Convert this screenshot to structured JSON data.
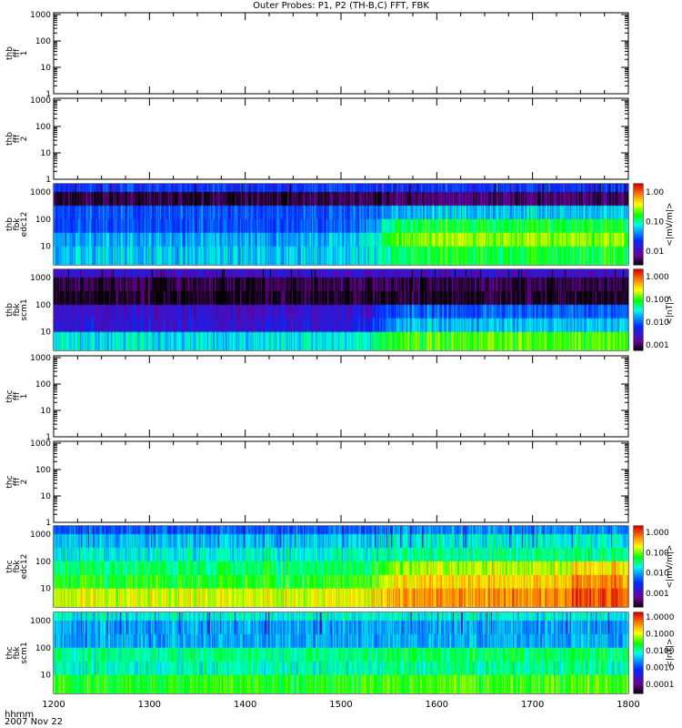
{
  "chart_data": {
    "type": "heatmap",
    "title": "Outer Probes: P1, P2 (TH-B,C) FFT, FBK",
    "xlabel": "hhmm",
    "date_label": "2007 Nov 22",
    "x_range": [
      1200,
      1800
    ],
    "x_ticks": [
      "1200",
      "1300",
      "1400",
      "1500",
      "1600",
      "1700",
      "1800"
    ],
    "panels": [
      {
        "label": [
          "thb",
          "fff",
          "1"
        ],
        "kind": "empty",
        "y_range": [
          1,
          1170
        ],
        "y_ticks": [
          "1000",
          "100",
          "10",
          "1"
        ]
      },
      {
        "label": [
          "thb",
          "fff",
          "2"
        ],
        "kind": "empty",
        "y_range": [
          1,
          1170
        ],
        "y_ticks": [
          "1000",
          "100",
          "10",
          "1"
        ]
      },
      {
        "label": [
          "thb",
          "fbk",
          "edc12"
        ],
        "kind": "spectrogram",
        "y_range": [
          2.1,
          2000
        ],
        "y_ticks": [
          "1000",
          "100",
          "10"
        ],
        "colorbar": {
          "unit": "<|mV/m|>",
          "ticks": [
            "1.00",
            "0.10",
            "0.01"
          ],
          "range": [
            0.0034,
            1.9
          ]
        },
        "band_levels_early_late": [
          [
            0.3,
            0.3
          ],
          [
            0.05,
            0.1
          ],
          [
            0.33,
            0.45
          ],
          [
            0.33,
            0.6
          ],
          [
            0.42,
            0.7
          ],
          [
            0.45,
            0.6
          ]
        ],
        "transition": 1540
      },
      {
        "label": [
          "thb",
          "fbk",
          "scm1"
        ],
        "kind": "spectrogram",
        "y_range": [
          2.1,
          2000
        ],
        "y_ticks": [
          "1000",
          "100",
          "10"
        ],
        "colorbar": {
          "unit": "<|nT|>",
          "ticks": [
            "1.000",
            "0.100",
            "0.010",
            "0.001"
          ],
          "range": [
            0.00058,
            2.1
          ]
        },
        "band_levels_early_late": [
          [
            0.2,
            0.2
          ],
          [
            0.05,
            0.06
          ],
          [
            0.02,
            0.03
          ],
          [
            0.2,
            0.35
          ],
          [
            0.22,
            0.45
          ],
          [
            0.48,
            0.65
          ]
        ],
        "transition": 1540
      },
      {
        "label": [
          "thc",
          "fff",
          "1"
        ],
        "kind": "empty",
        "y_range": [
          1,
          1170
        ],
        "y_ticks": [
          "1000",
          "100",
          "10",
          "1"
        ]
      },
      {
        "label": [
          "thc",
          "fff",
          "2"
        ],
        "kind": "empty",
        "y_range": [
          1,
          1170
        ],
        "y_ticks": [
          "1000",
          "100",
          "10",
          "1"
        ]
      },
      {
        "label": [
          "thc",
          "fbk",
          "edc12"
        ],
        "kind": "spectrogram",
        "y_range": [
          2.1,
          2000
        ],
        "y_ticks": [
          "1000",
          "100",
          "10"
        ],
        "colorbar": {
          "unit": "<|mV/m|>",
          "ticks": [
            "1.000",
            "0.100",
            "0.010",
            "0.001"
          ],
          "range": [
            0.00022,
            2.0
          ]
        },
        "band_levels_early_late": [
          [
            0.35,
            0.4
          ],
          [
            0.45,
            0.5
          ],
          [
            0.5,
            0.55
          ],
          [
            0.57,
            0.72
          ],
          [
            0.62,
            0.8
          ],
          [
            0.74,
            0.86
          ]
        ],
        "transition": 1545
      },
      {
        "label": [
          "thc",
          "fbk",
          "scm1"
        ],
        "kind": "spectrogram",
        "y_range": [
          2.1,
          2000
        ],
        "y_ticks": [
          "1000",
          "100",
          "10"
        ],
        "colorbar": {
          "unit": "<|nT|>",
          "ticks": [
            "1.0000",
            "0.1000",
            "0.0100",
            "0.0010",
            "0.0001"
          ],
          "range": [
            2.9e-05,
            1.9
          ]
        },
        "band_levels_early_late": [
          [
            0.5,
            0.5
          ],
          [
            0.42,
            0.42
          ],
          [
            0.42,
            0.43
          ],
          [
            0.55,
            0.58
          ],
          [
            0.52,
            0.55
          ],
          [
            0.62,
            0.65
          ]
        ],
        "transition": 1545
      }
    ]
  }
}
